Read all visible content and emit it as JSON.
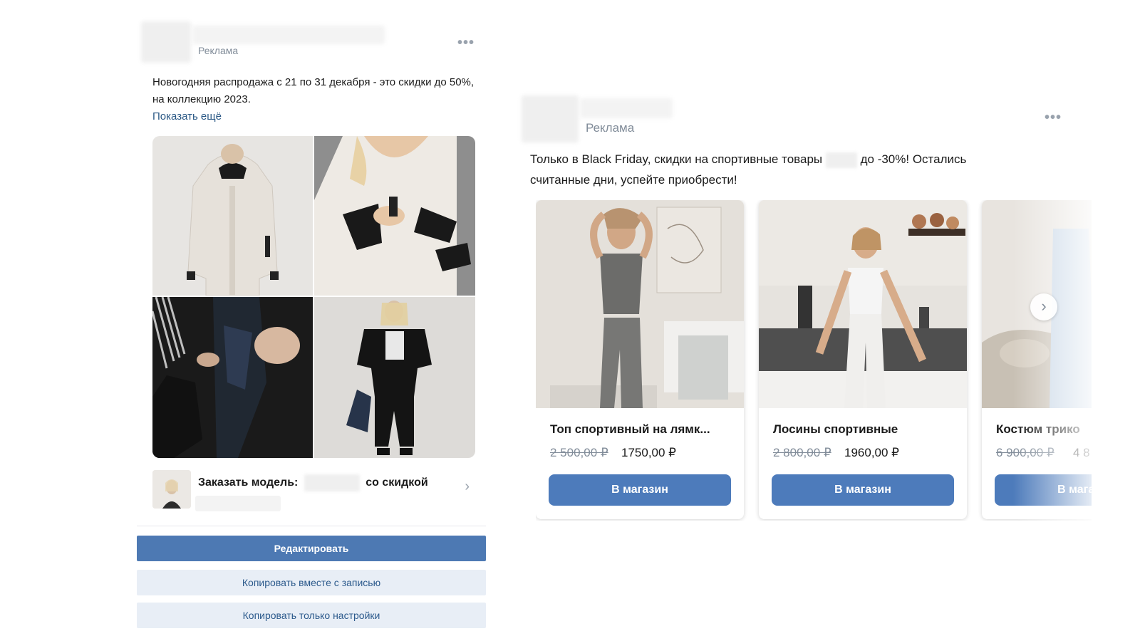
{
  "left_post": {
    "ad_label": "Реклама",
    "more_icon": "more-horizontal-icon",
    "text": "Новогодняя распродажа с 21 по 31 декабря - это скидки до 50%, на коллекцию 2023.",
    "show_more": "Показать ещё",
    "photos": [
      "white-jacket-photo",
      "jacket-closeup-photo",
      "black-coat-photo",
      "black-outfit-photo"
    ],
    "promo": {
      "text_before": "Заказать модель:",
      "text_after": "со скидкой",
      "chevron_icon": "chevron-right-icon"
    },
    "actions": {
      "edit": "Редактировать",
      "copy_with_post": "Копировать вместе с записью",
      "copy_settings": "Копировать только настройки"
    }
  },
  "right_post": {
    "ad_label": "Реклама",
    "more_icon": "more-horizontal-icon",
    "text_part1": "Только в Black Friday, скидки на спортивные товары",
    "text_part2": "до -30%! Остались",
    "text_line2": "считанные дни, успейте приобрести!",
    "products": [
      {
        "title": "Топ спортивный на лямк...",
        "old_price": "2 500,00 ₽",
        "new_price": "1750,00 ₽",
        "button": "В магазин"
      },
      {
        "title": "Лосины спортивные",
        "old_price": "2 800,00 ₽",
        "new_price": "1960,00 ₽",
        "button": "В магазин"
      },
      {
        "title": "Костюм трико",
        "old_price": "6 900,00 ₽",
        "new_price": "4 8",
        "button": "В магазин"
      }
    ],
    "next_icon": "chevron-right-icon"
  }
}
